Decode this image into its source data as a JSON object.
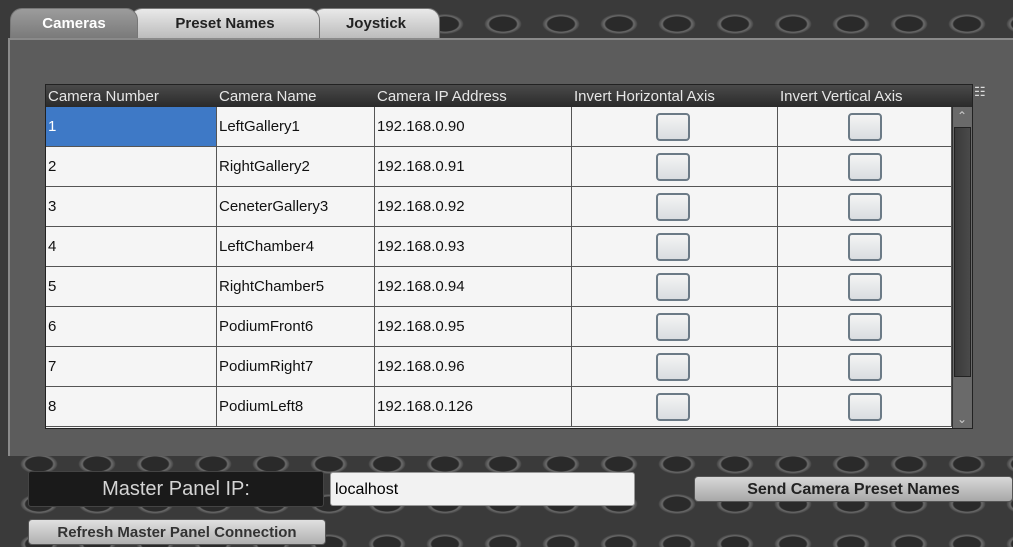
{
  "tabs": [
    {
      "label": "Cameras",
      "active": true
    },
    {
      "label": "Preset Names",
      "active": false
    },
    {
      "label": "Joystick",
      "active": false
    }
  ],
  "table": {
    "columns": [
      "Camera Number",
      "Camera Name",
      "Camera IP Address",
      "Invert Horizontal Axis",
      "Invert Vertical Axis"
    ],
    "rows": [
      {
        "number": "1",
        "name": "LeftGallery1",
        "ip": "192.168.0.90",
        "invert_h": false,
        "invert_v": false,
        "selected": true
      },
      {
        "number": "2",
        "name": "RightGallery2",
        "ip": "192.168.0.91",
        "invert_h": false,
        "invert_v": false
      },
      {
        "number": "3",
        "name": "CeneterGallery3",
        "ip": "192.168.0.92",
        "invert_h": false,
        "invert_v": false
      },
      {
        "number": "4",
        "name": "LeftChamber4",
        "ip": "192.168.0.93",
        "invert_h": false,
        "invert_v": false
      },
      {
        "number": "5",
        "name": "RightChamber5",
        "ip": "192.168.0.94",
        "invert_h": false,
        "invert_v": false
      },
      {
        "number": "6",
        "name": "PodiumFront6",
        "ip": "192.168.0.95",
        "invert_h": false,
        "invert_v": false
      },
      {
        "number": "7",
        "name": "PodiumRight7",
        "ip": "192.168.0.96",
        "invert_h": false,
        "invert_v": false
      },
      {
        "number": "8",
        "name": "PodiumLeft8",
        "ip": "192.168.0.126",
        "invert_h": false,
        "invert_v": false
      }
    ]
  },
  "master_panel": {
    "label": "Master Panel IP:",
    "value": "localhost"
  },
  "buttons": {
    "send_presets": "Send Camera Preset Names",
    "refresh": "Refresh Master Panel Connection"
  },
  "colors": {
    "selection": "#3e79c6",
    "background": "#3a3a3a"
  }
}
